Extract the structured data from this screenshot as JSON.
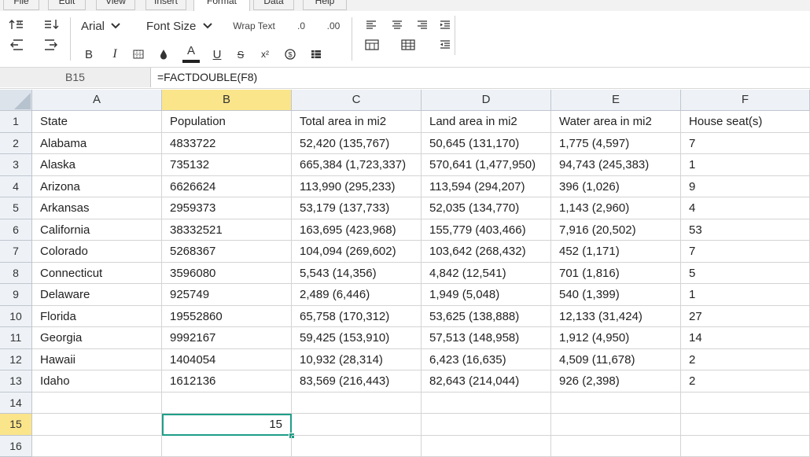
{
  "menu": [
    "File",
    "Edit",
    "View",
    "Insert",
    "Format",
    "Data",
    "Help"
  ],
  "active_menu": "Format",
  "toolbar": {
    "font_name": "Arial",
    "font_size": "Font Size",
    "wrap_text": "Wrap Text",
    "dec_decrease": ".0",
    "dec_increase": ".00",
    "bold": "B",
    "italic": "I",
    "underline": "U",
    "strike": "S",
    "superscript": "x²",
    "font_color_letter": "A",
    "accent": "#1f9e88"
  },
  "formula_bar": {
    "cell_ref": "B15",
    "formula": "=FACTDOUBLE(F8)"
  },
  "sheet": {
    "columns": [
      "A",
      "B",
      "C",
      "D",
      "E",
      "F"
    ],
    "selected_column": "B",
    "row_numbers": [
      "1",
      "2",
      "3",
      "4",
      "5",
      "6",
      "7",
      "8",
      "9",
      "10",
      "11",
      "12",
      "13",
      "14",
      "15",
      "16"
    ],
    "selected_row": "15",
    "rows": [
      [
        "State",
        "Population",
        "Total area in mi2",
        "Land area in mi2",
        "Water area in mi2",
        "House seat(s)"
      ],
      [
        "Alabama",
        "4833722",
        "52,420 (135,767)",
        "50,645 (131,170)",
        "1,775 (4,597)",
        "7"
      ],
      [
        "Alaska",
        "735132",
        "665,384 (1,723,337)",
        "570,641 (1,477,950)",
        "94,743 (245,383)",
        "1"
      ],
      [
        "Arizona",
        "6626624",
        "113,990 (295,233)",
        "113,594 (294,207)",
        "396 (1,026)",
        "9"
      ],
      [
        "Arkansas",
        "2959373",
        "53,179 (137,733)",
        "52,035 (134,770)",
        "1,143 (2,960)",
        "4"
      ],
      [
        "California",
        "38332521",
        "163,695 (423,968)",
        "155,779 (403,466)",
        "7,916 (20,502)",
        "53"
      ],
      [
        "Colorado",
        "5268367",
        "104,094 (269,602)",
        "103,642 (268,432)",
        "452 (1,171)",
        "7"
      ],
      [
        "Connecticut",
        "3596080",
        "5,543 (14,356)",
        "4,842 (12,541)",
        "701 (1,816)",
        "5"
      ],
      [
        "Delaware",
        "925749",
        "2,489 (6,446)",
        "1,949 (5,048)",
        "540 (1,399)",
        "1"
      ],
      [
        "Florida",
        "19552860",
        "65,758 (170,312)",
        "53,625 (138,888)",
        "12,133 (31,424)",
        "27"
      ],
      [
        "Georgia",
        "9992167",
        "59,425 (153,910)",
        "57,513 (148,958)",
        "1,912 (4,950)",
        "14"
      ],
      [
        "Hawaii",
        "1404054",
        "10,932 (28,314)",
        "6,423 (16,635)",
        "4,509 (11,678)",
        "2"
      ],
      [
        "Idaho",
        "1612136",
        "83,569 (216,443)",
        "82,643 (214,044)",
        "926 (2,398)",
        "2"
      ],
      [
        "",
        "",
        "",
        "",
        "",
        ""
      ],
      [
        "",
        "15",
        "",
        "",
        "",
        ""
      ],
      [
        "",
        "",
        "",
        "",
        "",
        ""
      ]
    ]
  }
}
